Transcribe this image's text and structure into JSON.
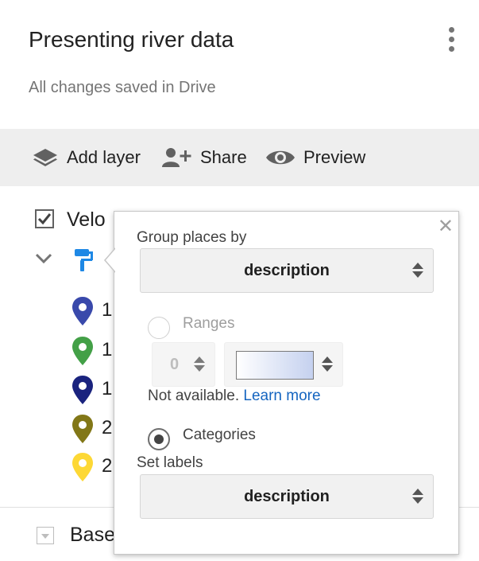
{
  "header": {
    "title": "Presenting river data",
    "status": "All changes saved in Drive"
  },
  "toolbar": {
    "add_layer": "Add layer",
    "share": "Share",
    "preview": "Preview"
  },
  "layer": {
    "name": "Velo",
    "checked": true,
    "pins": [
      {
        "label": "1",
        "color": "#3949ab"
      },
      {
        "label": "1",
        "color": "#43a047"
      },
      {
        "label": "1",
        "color": "#1a237e"
      },
      {
        "label": "2",
        "color": "#827717"
      },
      {
        "label": "2",
        "color": "#fdd835"
      }
    ]
  },
  "base_layer": {
    "name": "Base"
  },
  "popup": {
    "group_label": "Group places by",
    "group_select": "description",
    "ranges_label": "Ranges",
    "ranges_value": "0",
    "not_available": "Not available.",
    "learn_more": "Learn more",
    "categories_label": "Categories",
    "set_labels_label": "Set labels",
    "labels_select": "description"
  },
  "colors": {
    "accent": "#1565c0",
    "paint_icon": "#1e88e5",
    "toolbar_bg": "#eeeeee"
  }
}
